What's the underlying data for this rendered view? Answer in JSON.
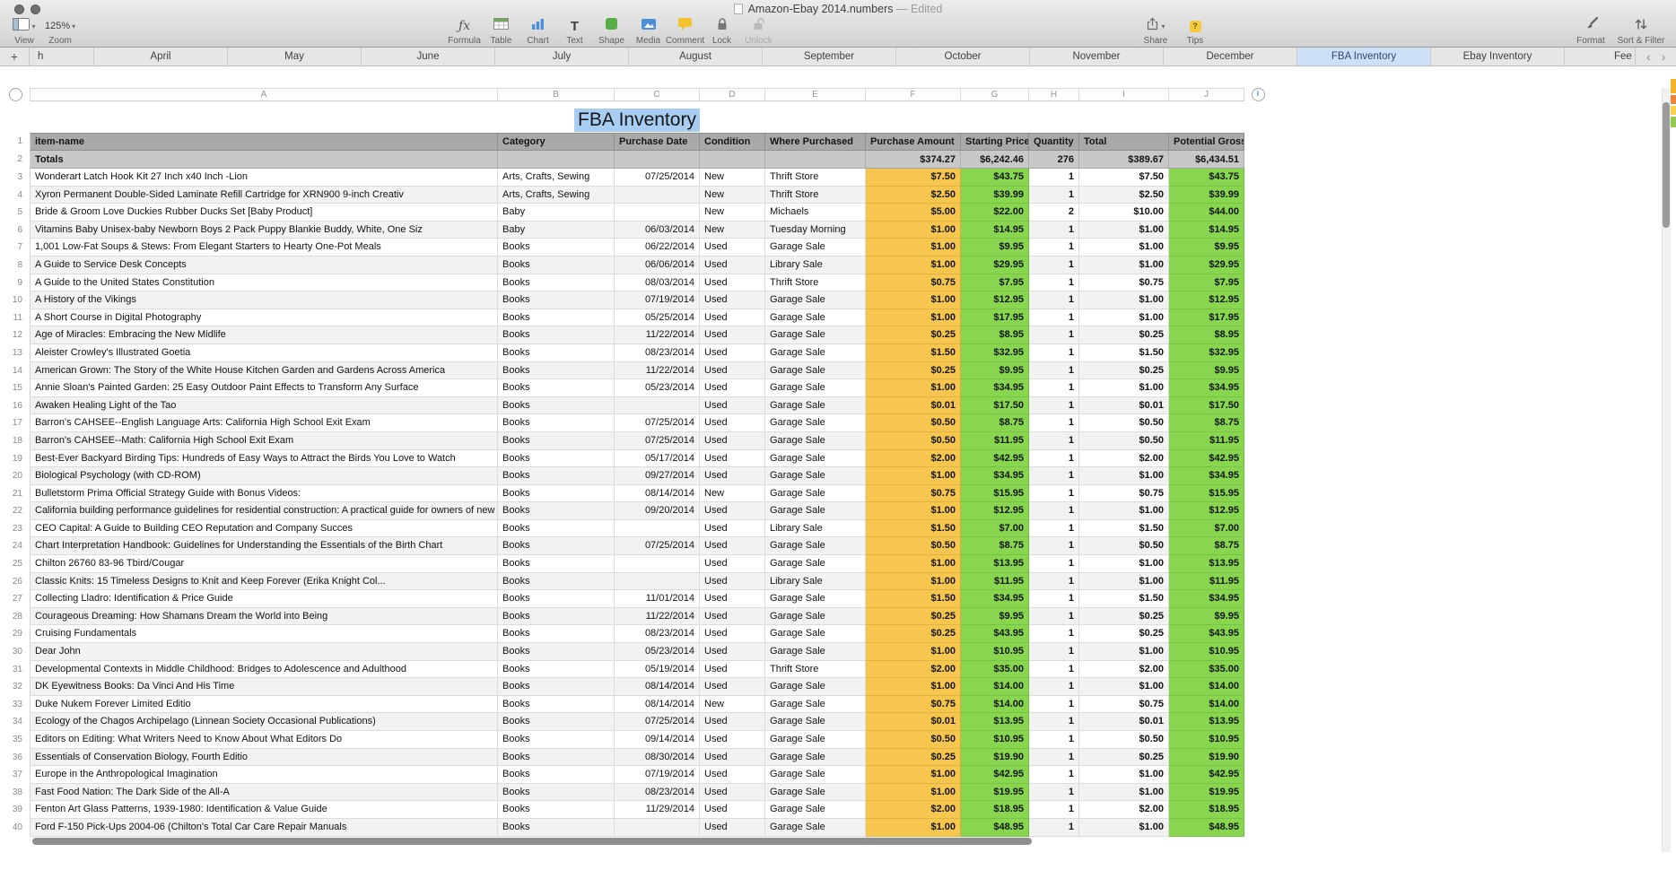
{
  "window": {
    "title": "Amazon-Ebay 2014.numbers",
    "edited_suffix": " — Edited"
  },
  "toolbar": {
    "view": {
      "label": "View"
    },
    "zoom": {
      "label": "Zoom",
      "value": "125%"
    },
    "items": [
      {
        "id": "formula",
        "label": "Formula"
      },
      {
        "id": "table",
        "label": "Table"
      },
      {
        "id": "chart",
        "label": "Chart"
      },
      {
        "id": "text",
        "label": "Text"
      },
      {
        "id": "shape",
        "label": "Shape"
      },
      {
        "id": "media",
        "label": "Media"
      },
      {
        "id": "comment",
        "label": "Comment"
      },
      {
        "id": "lock",
        "label": "Lock"
      },
      {
        "id": "unlock",
        "label": "Unlock"
      }
    ],
    "share": {
      "label": "Share"
    },
    "tips": {
      "label": "Tips"
    },
    "format": {
      "label": "Format"
    },
    "sort_filter": {
      "label": "Sort & Filter"
    }
  },
  "tabs": {
    "add_button": "+",
    "active": "FBA Inventory",
    "nav_prev": "‹",
    "nav_next": "›",
    "items": [
      {
        "label": "h",
        "partial": "first"
      },
      {
        "label": "April"
      },
      {
        "label": "May"
      },
      {
        "label": "June"
      },
      {
        "label": "July"
      },
      {
        "label": "August"
      },
      {
        "label": "September"
      },
      {
        "label": "October"
      },
      {
        "label": "November"
      },
      {
        "label": "December"
      },
      {
        "label": "FBA Inventory"
      },
      {
        "label": "Ebay Inventory"
      },
      {
        "label": "Fee",
        "partial": "last"
      }
    ]
  },
  "column_letters": [
    "A",
    "B",
    "C",
    "D",
    "E",
    "F",
    "G",
    "H",
    "I",
    "J"
  ],
  "sheet": {
    "title": "FBA Inventory",
    "header_row_number": "1",
    "headers": [
      "item-name",
      "Category",
      "Purchase Date",
      "Condition",
      "Where Purchased",
      "Purchase Amount",
      "Starting Price",
      "Quantity",
      "Total",
      "Potential Gross"
    ],
    "totals": {
      "row_number": "2",
      "label": "Totals",
      "values": [
        "$374.27",
        "$6,242.46",
        "276",
        "$389.67",
        "$6,434.51"
      ]
    },
    "rows": [
      [
        "Wonderart Latch Hook Kit 27 Inch x40 Inch -Lion",
        "Arts, Crafts, Sewing",
        "07/25/2014",
        "New",
        "Thrift Store",
        "$7.50",
        "$43.75",
        "1",
        "$7.50",
        "$43.75"
      ],
      [
        "Xyron Permanent Double-Sided Laminate Refill Cartridge for XRN900 9-inch Creativ",
        "Arts, Crafts, Sewing",
        "",
        "New",
        "Thrift Store",
        "$2.50",
        "$39.99",
        "1",
        "$2.50",
        "$39.99"
      ],
      [
        "Bride & Groom Love Duckies Rubber Ducks Set [Baby Product]",
        "Baby",
        "",
        "New",
        "Michaels",
        "$5.00",
        "$22.00",
        "2",
        "$10.00",
        "$44.00"
      ],
      [
        "Vitamins Baby Unisex-baby Newborn Boys 2 Pack Puppy Blankie Buddy, White, One Siz",
        "Baby",
        "06/03/2014",
        "New",
        "Tuesday Morning",
        "$1.00",
        "$14.95",
        "1",
        "$1.00",
        "$14.95"
      ],
      [
        "1,001 Low-Fat Soups & Stews: From Elegant Starters to Hearty One-Pot Meals",
        "Books",
        "06/22/2014",
        "Used",
        "Garage Sale",
        "$1.00",
        "$9.95",
        "1",
        "$1.00",
        "$9.95"
      ],
      [
        "A Guide to Service Desk Concepts",
        "Books",
        "06/06/2014",
        "Used",
        "Library Sale",
        "$1.00",
        "$29.95",
        "1",
        "$1.00",
        "$29.95"
      ],
      [
        "A Guide to the United States Constitution",
        "Books",
        "08/03/2014",
        "Used",
        "Thrift Store",
        "$0.75",
        "$7.95",
        "1",
        "$0.75",
        "$7.95"
      ],
      [
        "A History of the Vikings",
        "Books",
        "07/19/2014",
        "Used",
        "Garage Sale",
        "$1.00",
        "$12.95",
        "1",
        "$1.00",
        "$12.95"
      ],
      [
        "A Short Course in Digital Photography",
        "Books",
        "05/25/2014",
        "Used",
        "Garage Sale",
        "$1.00",
        "$17.95",
        "1",
        "$1.00",
        "$17.95"
      ],
      [
        "Age of Miracles: Embracing the New Midlife",
        "Books",
        "11/22/2014",
        "Used",
        "Garage Sale",
        "$0.25",
        "$8.95",
        "1",
        "$0.25",
        "$8.95"
      ],
      [
        "Aleister Crowley's Illustrated Goetia",
        "Books",
        "08/23/2014",
        "Used",
        "Garage Sale",
        "$1.50",
        "$32.95",
        "1",
        "$1.50",
        "$32.95"
      ],
      [
        "American Grown: The Story of the White House Kitchen Garden and Gardens Across America",
        "Books",
        "11/22/2014",
        "Used",
        "Garage Sale",
        "$0.25",
        "$9.95",
        "1",
        "$0.25",
        "$9.95"
      ],
      [
        "Annie Sloan's Painted Garden: 25 Easy Outdoor Paint Effects to Transform Any Surface",
        "Books",
        "05/23/2014",
        "Used",
        "Garage Sale",
        "$1.00",
        "$34.95",
        "1",
        "$1.00",
        "$34.95"
      ],
      [
        "Awaken Healing Light of the Tao",
        "Books",
        "",
        "Used",
        "Garage Sale",
        "$0.01",
        "$17.50",
        "1",
        "$0.01",
        "$17.50"
      ],
      [
        "Barron's CAHSEE--English Language Arts: California High School Exit Exam",
        "Books",
        "07/25/2014",
        "Used",
        "Garage Sale",
        "$0.50",
        "$8.75",
        "1",
        "$0.50",
        "$8.75"
      ],
      [
        "Barron's CAHSEE--Math: California High School Exit Exam",
        "Books",
        "07/25/2014",
        "Used",
        "Garage Sale",
        "$0.50",
        "$11.95",
        "1",
        "$0.50",
        "$11.95"
      ],
      [
        "Best-Ever Backyard Birding Tips: Hundreds of Easy Ways to Attract the Birds You Love to Watch",
        "Books",
        "05/17/2014",
        "Used",
        "Garage Sale",
        "$2.00",
        "$42.95",
        "1",
        "$2.00",
        "$42.95"
      ],
      [
        "Biological Psychology (with CD-ROM)",
        "Books",
        "09/27/2014",
        "Used",
        "Garage Sale",
        "$1.00",
        "$34.95",
        "1",
        "$1.00",
        "$34.95"
      ],
      [
        "Bulletstorm Prima Official Strategy Guide with Bonus Videos:",
        "Books",
        "08/14/2014",
        "New",
        "Garage Sale",
        "$0.75",
        "$15.95",
        "1",
        "$0.75",
        "$15.95"
      ],
      [
        "California building performance guidelines for residential construction: A practical guide for owners of new homes : constr",
        "Books",
        "09/20/2014",
        "Used",
        "Garage Sale",
        "$1.00",
        "$12.95",
        "1",
        "$1.00",
        "$12.95"
      ],
      [
        "CEO Capital: A Guide to Building CEO Reputation and Company Succes",
        "Books",
        "",
        "Used",
        "Library Sale",
        "$1.50",
        "$7.00",
        "1",
        "$1.50",
        "$7.00"
      ],
      [
        "Chart Interpretation Handbook: Guidelines for Understanding the Essentials of the Birth Chart",
        "Books",
        "07/25/2014",
        "Used",
        "Garage Sale",
        "$0.50",
        "$8.75",
        "1",
        "$0.50",
        "$8.75"
      ],
      [
        "Chilton 26760 83-96 Tbird/Cougar",
        "Books",
        "",
        "Used",
        "Garage Sale",
        "$1.00",
        "$13.95",
        "1",
        "$1.00",
        "$13.95"
      ],
      [
        "Classic Knits: 15 Timeless Designs to Knit and Keep Forever (Erika Knight Col...",
        "Books",
        "",
        "Used",
        "Library Sale",
        "$1.00",
        "$11.95",
        "1",
        "$1.00",
        "$11.95"
      ],
      [
        "Collecting Lladro: Identification & Price Guide",
        "Books",
        "11/01/2014",
        "Used",
        "Garage Sale",
        "$1.50",
        "$34.95",
        "1",
        "$1.50",
        "$34.95"
      ],
      [
        "Courageous Dreaming: How Shamans Dream the World into Being",
        "Books",
        "11/22/2014",
        "Used",
        "Garage Sale",
        "$0.25",
        "$9.95",
        "1",
        "$0.25",
        "$9.95"
      ],
      [
        "Cruising Fundamentals",
        "Books",
        "08/23/2014",
        "Used",
        "Garage Sale",
        "$0.25",
        "$43.95",
        "1",
        "$0.25",
        "$43.95"
      ],
      [
        "Dear John",
        "Books",
        "05/23/2014",
        "Used",
        "Garage Sale",
        "$1.00",
        "$10.95",
        "1",
        "$1.00",
        "$10.95"
      ],
      [
        "Developmental Contexts in Middle Childhood: Bridges to Adolescence and Adulthood",
        "Books",
        "05/19/2014",
        "Used",
        "Thrift Store",
        "$2.00",
        "$35.00",
        "1",
        "$2.00",
        "$35.00"
      ],
      [
        "DK Eyewitness Books: Da Vinci And His Time",
        "Books",
        "08/14/2014",
        "Used",
        "Garage Sale",
        "$1.00",
        "$14.00",
        "1",
        "$1.00",
        "$14.00"
      ],
      [
        "Duke Nukem Forever Limited Editio",
        "Books",
        "08/14/2014",
        "New",
        "Garage Sale",
        "$0.75",
        "$14.00",
        "1",
        "$0.75",
        "$14.00"
      ],
      [
        "Ecology of the Chagos Archipelago (Linnean Society Occasional Publications)",
        "Books",
        "07/25/2014",
        "Used",
        "Garage Sale",
        "$0.01",
        "$13.95",
        "1",
        "$0.01",
        "$13.95"
      ],
      [
        "Editors on Editing: What Writers Need to Know About What Editors Do",
        "Books",
        "09/14/2014",
        "Used",
        "Garage Sale",
        "$0.50",
        "$10.95",
        "1",
        "$0.50",
        "$10.95"
      ],
      [
        "Essentials of Conservation Biology, Fourth Editio",
        "Books",
        "08/30/2014",
        "Used",
        "Garage Sale",
        "$0.25",
        "$19.90",
        "1",
        "$0.25",
        "$19.90"
      ],
      [
        "Europe in the Anthropological Imagination",
        "Books",
        "07/19/2014",
        "Used",
        "Garage Sale",
        "$1.00",
        "$42.95",
        "1",
        "$1.00",
        "$42.95"
      ],
      [
        "Fast Food Nation: The Dark Side of the All-A",
        "Books",
        "08/23/2014",
        "Used",
        "Garage Sale",
        "$1.00",
        "$19.95",
        "1",
        "$1.00",
        "$19.95"
      ],
      [
        "Fenton Art Glass Patterns, 1939-1980: Identification & Value Guide",
        "Books",
        "11/29/2014",
        "Used",
        "Garage Sale",
        "$2.00",
        "$18.95",
        "1",
        "$2.00",
        "$18.95"
      ],
      [
        "Ford F-150 Pick-Ups 2004-06 (Chilton's Total Car Care Repair Manuals",
        "Books",
        "",
        "Used",
        "Garage Sale",
        "$1.00",
        "$48.95",
        "1",
        "$1.00",
        "$48.95"
      ]
    ]
  },
  "table_handle_glyph": "‖",
  "colors": {
    "purchase_amount_bg": "#f6c64f",
    "price_bg": "#88d64f",
    "active_tab_bg": "#cce0f7",
    "title_selection_bg": "#a8cdf3",
    "header_row_bg": "#a9a9a9",
    "totals_row_bg": "#c8c8c8"
  }
}
